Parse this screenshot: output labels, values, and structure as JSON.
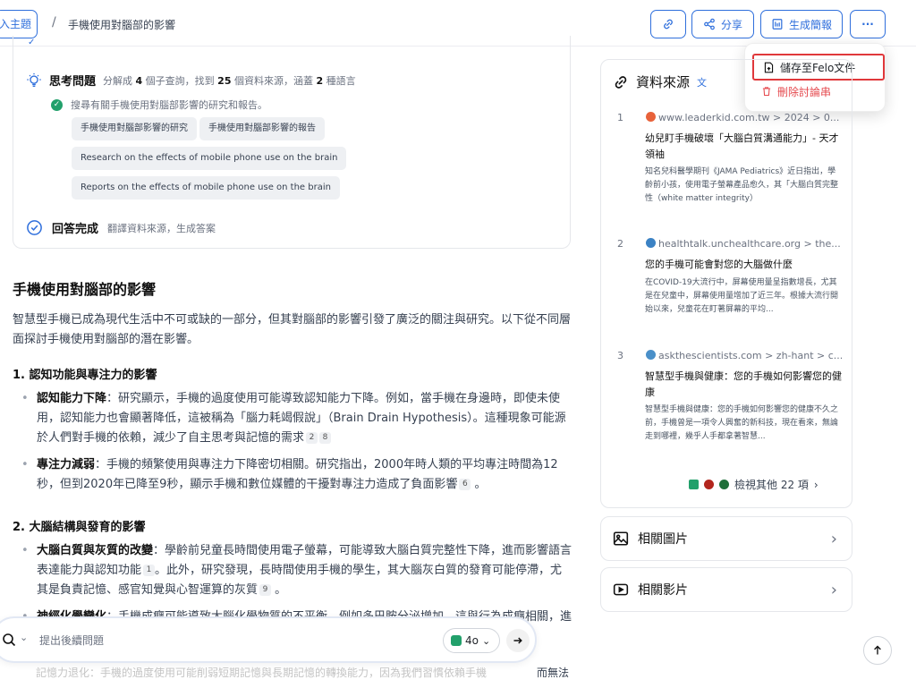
{
  "header": {
    "back_label": "入主題",
    "separator": "/",
    "title": "手機使用對腦部的影響",
    "share_label": "分享",
    "brief_label": "生成簡報",
    "more_label": "···"
  },
  "menu": {
    "save_label": "儲存至Felo文件",
    "delete_label": "刪除討論串"
  },
  "thinking": {
    "title": "思考問題",
    "summary_pre": "分解成",
    "queries": "4",
    "summary_mid1": "個子查詢，找到",
    "sources": "25",
    "summary_mid2": "個資料來源，涵蓋",
    "langs": "2",
    "summary_post": "種語言",
    "search_text": "搜尋有關手機使用對腦部影響的研究和報告。",
    "chips": [
      "手機使用對腦部影響的研究",
      "手機使用對腦部影響的報告",
      "Research on the effects of mobile phone use on the brain",
      "Reports on the effects of mobile phone use on the brain"
    ],
    "done_title": "回答完成",
    "done_sub": "翻譯資料來源，生成答案"
  },
  "answer": {
    "title": "手機使用對腦部的影響",
    "intro": "智慧型手機已成為現代生活中不可或缺的一部分，但其對腦部的影響引發了廣泛的關注與研究。以下從不同層面探討手機使用對腦部的潛在影響。",
    "s1_title": "1. 認知功能與專注力的影響",
    "b1_label": "認知能力下降",
    "b1_text": "：研究顯示，手機的過度使用可能導致認知能力下降。例如，當手機在身邊時，即使未使用，認知能力也會顯著降低，這被稱為「腦力耗竭假說」（Brain Drain Hypothesis）。這種現象可能源於人們對手機的依賴，減少了自主思考與記憶的需求",
    "b1_cites": [
      "2",
      "8"
    ],
    "b2_label": "專注力減弱",
    "b2_text": "：手機的頻繁使用與專注力下降密切相關。研究指出，2000年時人類的平均專注時間為12秒，但到2020年已降至9秒，顯示手機和數位媒體的干擾對專注力造成了負面影響",
    "b2_cites": [
      "6"
    ],
    "s2_title": "2. 大腦結構與發育的影響",
    "b3_label": "大腦白質與灰質的改變",
    "b3_text_a": "：學齡前兒童長時間使用電子螢幕，可能導致大腦白質完整性下降，進而影響語言表達能力與認知功能",
    "b3_cite_a": "1",
    "b3_text_b": "。此外，研究發現，長時間使用手機的學生，其大腦灰白質的發育可能停滯，尤其是負責記憶、感官知覺與心智運算的灰質",
    "b3_cite_b": "9",
    "b4_label": "神經化學變化",
    "b4_text": "：手機成癮可能導致大腦化學物質的不平衡，例如多巴胺分泌增加，這與行為成癮相關，進一步影響大腦的自控能力",
    "b4_cites": [
      "6",
      "8"
    ],
    "trailing_faded": "記憶力退化：手機的過度使用可能削弱短期記憶與長期記憶的轉換能力，因為我們習慣依賴手機",
    "trailing_end": "而無法"
  },
  "composer": {
    "placeholder": "提出後續問題",
    "model": "4o"
  },
  "sources_panel": {
    "title": "資料來源",
    "items": [
      {
        "num": "1",
        "site": "www.leaderkid.com.tw > 2024 > 0...",
        "title": "幼兒盯手機破壞「大腦白質溝通能力」- 天才領袖",
        "snippet": "知名兒科醫學期刊《JAMA Pediatrics》近日指出，學齡前小孩，使用電子螢幕產品愈久，其「大腦白質完整性（white matter integrity）",
        "color": "#e8623a"
      },
      {
        "num": "2",
        "site": "healthtalk.unchealthcare.org > the...",
        "title": "您的手機可能會對您的大腦做什麼",
        "snippet": "在COVID-19大流行中，屏幕使用量呈指數增長，尤其是在兒童中，屏幕使用量增加了近三年。根據大流行開始以來，兒童花在盯著屏幕的平均...",
        "color": "#3b82c4"
      },
      {
        "num": "3",
        "site": "askthescientists.com > zh-hant > c...",
        "title": "智慧型手機與健康：您的手機如何影響您的健康",
        "snippet": "智慧型手機與健康：您的手機如何影響您的健康不久之前，手機曾是一項令人興奮的新科技，現在看來，無論走到哪裡，幾乎人手都拿著智慧...",
        "color": "#4a90c9"
      }
    ],
    "more_label": "檢視其他 22 項"
  },
  "related": {
    "images_label": "相關圖片",
    "videos_label": "相關影片"
  },
  "colors": {
    "accent": "#2f6fdc",
    "danger": "#e5484d",
    "success": "#22a06b"
  }
}
